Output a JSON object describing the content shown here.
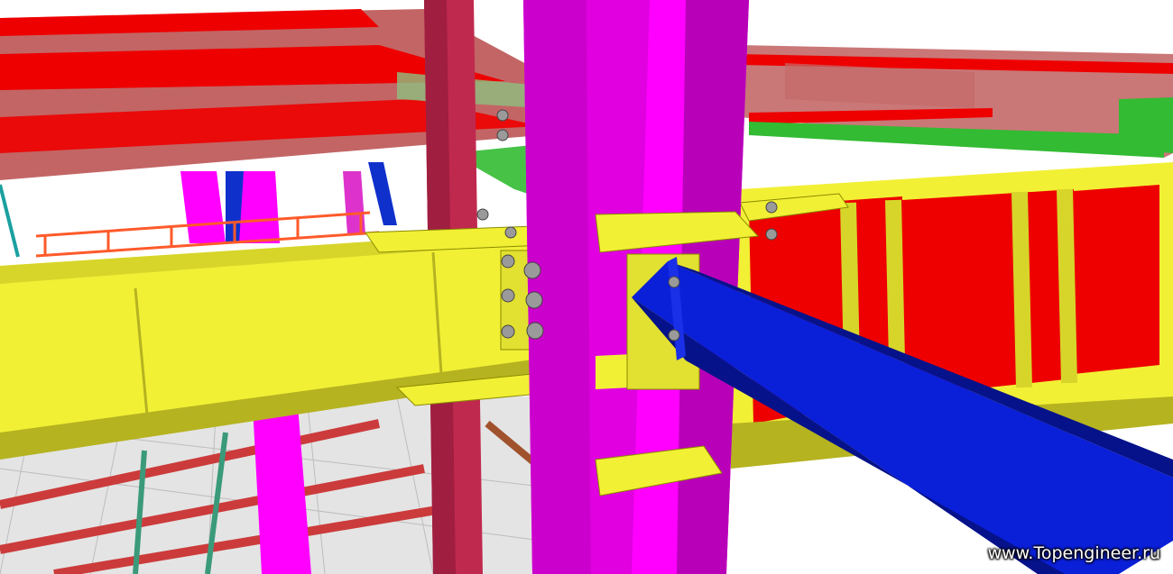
{
  "watermark": {
    "text": "www.Topengineer.ru"
  },
  "colors": {
    "column": "#ff00ff",
    "column_dark": "#b800b8",
    "yellow_beam": "#f2f035",
    "yellow_dark": "#b5b320",
    "red_beam": "#ee0000",
    "red_translucent": "#b84a4a",
    "green_beam": "#33bb33",
    "blue_beam": "#0a1fd8",
    "blue_dark": "#06128a",
    "maroon_column": "#c0294e",
    "bolt": "#9a9a9a",
    "grid_floor": "#dcdcdc"
  },
  "icons": [
    "bolt-icon"
  ]
}
